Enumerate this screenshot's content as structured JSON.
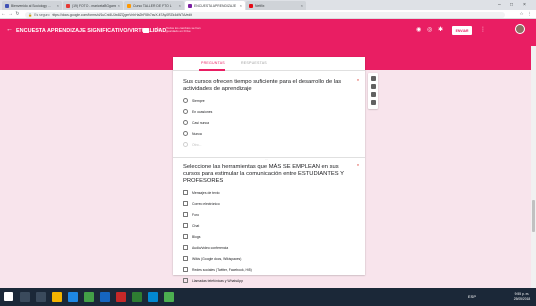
{
  "browser": {
    "tabs": [
      {
        "title": "Bienvenido al Sociology ...",
        "color": "#3f51b5"
      },
      {
        "title": "(19) FOTO - maricelaBGgame",
        "color": "#e53935"
      },
      {
        "title": "Curso TALLER DE FTO L",
        "color": "#ff9800"
      },
      {
        "title": "ENCUESTA APRENDIZAJE",
        "color": "#7b1fa2"
      },
      {
        "title": "Netflix",
        "color": "#e50914"
      }
    ],
    "secure_label": "Es seguro",
    "url": "https://docs.google.com/forms/d/1uCnl4UJw8ZQgmVnhHa2hFl8h7avX-it7Ay0RZk4dW7A/edit"
  },
  "header": {
    "title": "ENCUESTA APRENDIZAJE SIGNIFICATIVO/VIRTUALIDAD",
    "note": "Todos los cambios se han guardado en Drive",
    "send_label": "ENVIAR"
  },
  "form_tabs": {
    "questions": "PREGUNTAS",
    "responses": "RESPUESTAS"
  },
  "questions": [
    {
      "title": "Sus cursos ofrecen tiempo suficiente para el desarrollo de las actividades de aprendizaje",
      "required_mark": "*",
      "options": [
        "Siempre",
        "En ocasiones",
        "Casi nunca",
        "Nunca",
        "Otro..."
      ]
    },
    {
      "title": "Seleccione las herramientas que MÁS SE EMPLEAN en sus cursos para estimular la comunicación entre ESTUDIANTES Y PROFESORES",
      "required_mark": "*",
      "options": [
        "Mensajes de texto",
        "Correo electrónico",
        "Foro",
        "Chat",
        "Blogs",
        "Audio/video conferencia",
        "Wikis (Google docs, Wikispaces)",
        "Redes sociales (Twitter, Facebook, Hi5)",
        "Llamadas telefónicas y WhatsApp"
      ]
    }
  ],
  "taskbar": {
    "tray_text": "ESP",
    "time": "9:55 p. m.",
    "date": "25/05/2018"
  },
  "colors": {
    "accent": "#e91e63",
    "background": "#f8e4ec"
  }
}
